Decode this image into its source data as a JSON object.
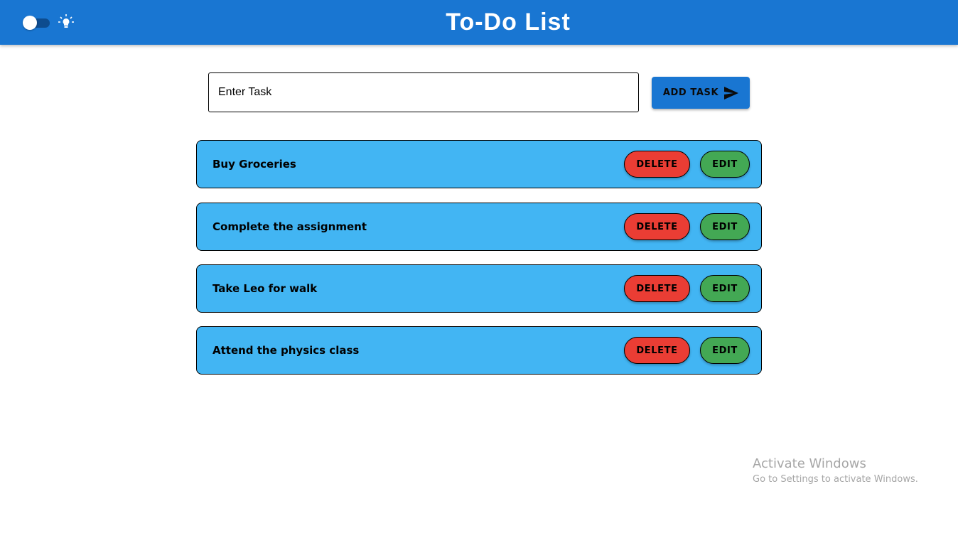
{
  "header": {
    "title": "To-Do List",
    "theme_toggle_icon": "toggle-switch-icon",
    "bulb_icon": "lightbulb-icon",
    "accent_color": "#1976d2"
  },
  "task_form": {
    "placeholder": "Enter Task",
    "value": "",
    "add_label": "ADD TASK",
    "add_icon": "send-icon"
  },
  "tasks": [
    {
      "text": "Buy Groceries",
      "delete_label": "DELETE",
      "edit_label": "EDIT"
    },
    {
      "text": "Complete the assignment",
      "delete_label": "DELETE",
      "edit_label": "EDIT"
    },
    {
      "text": "Take Leo for walk",
      "delete_label": "DELETE",
      "edit_label": "EDIT"
    },
    {
      "text": "Attend the physics class",
      "delete_label": "DELETE",
      "edit_label": "EDIT"
    }
  ],
  "colors": {
    "card_background": "#42b5f3",
    "delete_button": "#ea3d34",
    "edit_button": "#43a854"
  },
  "watermark": {
    "title": "Activate Windows",
    "subtitle": "Go to Settings to activate Windows."
  }
}
